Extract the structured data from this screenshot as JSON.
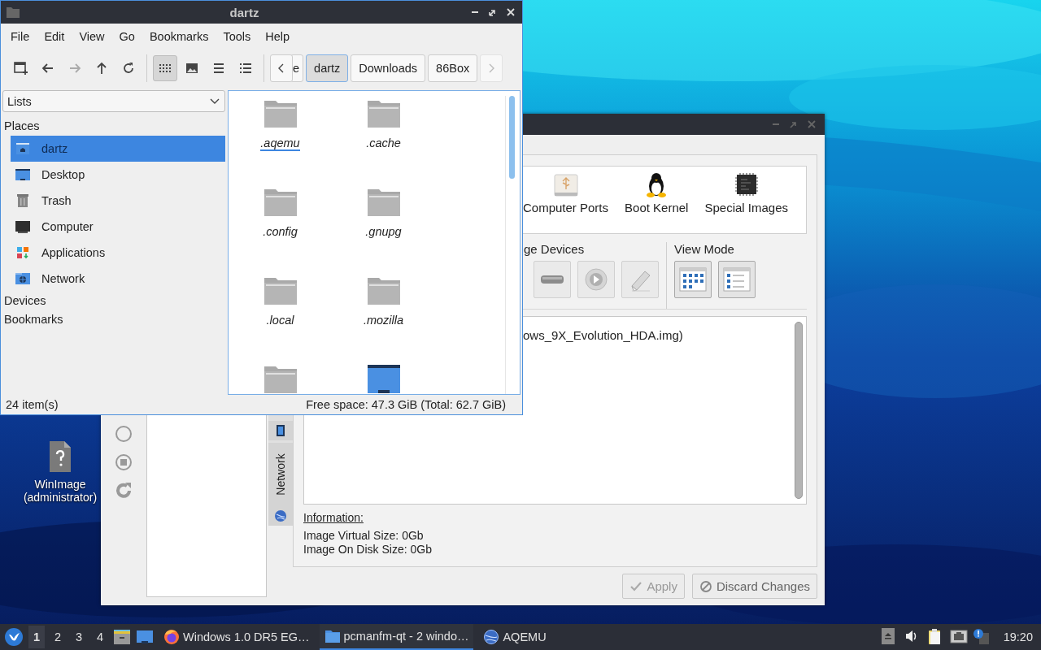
{
  "desktop": {
    "icons": [
      {
        "label": "WinImage (administrator)",
        "kind": "unknown"
      }
    ]
  },
  "aqemu_window": {
    "tool_icons": [
      {
        "kind": "circle"
      },
      {
        "kind": "stop"
      },
      {
        "kind": "reload"
      }
    ],
    "side_tabs": [
      {
        "kind": "device"
      },
      {
        "kind": "network",
        "label": "Network"
      }
    ],
    "categories": [
      {
        "label": "Computer Ports",
        "kind": "usb"
      },
      {
        "label": "Boot Kernel",
        "kind": "penguin"
      },
      {
        "label": "Special Images",
        "kind": "chip"
      }
    ],
    "devices_group": {
      "label": "ge Devices",
      "buttons": [
        {
          "kind": "drive"
        },
        {
          "kind": "media"
        },
        {
          "kind": "eraser"
        }
      ]
    },
    "view_mode": {
      "label": "View Mode",
      "buttons": [
        {
          "kind": "icons"
        },
        {
          "kind": "list"
        }
      ]
    },
    "image_list": [
      "ows_9X_Evolution_HDA.img)"
    ],
    "information": {
      "heading": "Information:",
      "lines": [
        "Image Virtual Size: 0Gb",
        "Image On Disk Size: 0Gb"
      ]
    },
    "buttons": [
      {
        "label": "Apply",
        "kind": "apply",
        "disabled": true
      },
      {
        "label": "Discard Changes",
        "kind": "discard",
        "disabled": false
      }
    ]
  },
  "file_manager": {
    "title": "dartz",
    "menu": [
      "File",
      "Edit",
      "View",
      "Go",
      "Bookmarks",
      "Tools",
      "Help"
    ],
    "nav_buttons": [
      {
        "kind": "new-tab",
        "disabled": false
      },
      {
        "kind": "back",
        "disabled": false
      },
      {
        "kind": "forward",
        "disabled": true
      },
      {
        "kind": "up",
        "disabled": false
      },
      {
        "kind": "reload",
        "disabled": false
      }
    ],
    "view_modes": [
      {
        "kind": "icons",
        "selected": true
      },
      {
        "kind": "thumbnails",
        "selected": false
      },
      {
        "kind": "compact",
        "selected": false
      },
      {
        "kind": "details",
        "selected": false
      }
    ],
    "path": [
      {
        "label": "e",
        "selected": false
      },
      {
        "label": "dartz",
        "selected": true
      },
      {
        "label": "Downloads",
        "selected": false
      },
      {
        "label": "86Box",
        "selected": false
      }
    ],
    "side_pane": {
      "selector": "Lists",
      "sections": [
        {
          "label": "Places",
          "items": [
            {
              "label": "dartz",
              "kind": "home",
              "selected": true
            },
            {
              "label": "Desktop",
              "kind": "desktop",
              "selected": false
            },
            {
              "label": "Trash",
              "kind": "trash",
              "selected": false
            },
            {
              "label": "Computer",
              "kind": "computer",
              "selected": false
            },
            {
              "label": "Applications",
              "kind": "applications",
              "selected": false
            },
            {
              "label": "Network",
              "kind": "network",
              "selected": false
            }
          ]
        },
        {
          "label": "Devices"
        },
        {
          "label": "Bookmarks"
        }
      ]
    },
    "files": [
      {
        "name": ".aqemu",
        "kind": "folder",
        "focused": true
      },
      {
        "name": ".cache",
        "kind": "folder",
        "focused": false
      },
      {
        "name": ".config",
        "kind": "folder",
        "focused": false
      },
      {
        "name": ".gnupg",
        "kind": "folder",
        "focused": false
      },
      {
        "name": ".local",
        "kind": "folder",
        "focused": false
      },
      {
        "name": ".mozilla",
        "kind": "folder",
        "focused": false
      },
      {
        "kind": "folder",
        "focused": false
      },
      {
        "kind": "desktop",
        "focused": false
      }
    ],
    "status_bar": {
      "count": "24 item(s)",
      "free_space": "Free space: 47.3 GiB (Total: 62.7 GiB)"
    }
  },
  "taskbar": {
    "workspaces": [
      {
        "label": "1",
        "selected": true
      },
      {
        "label": "2",
        "selected": false
      },
      {
        "label": "3",
        "selected": false
      },
      {
        "label": "4",
        "selected": false
      }
    ],
    "launchers": [
      {
        "kind": "file-manager"
      },
      {
        "kind": "desktop"
      }
    ],
    "tasks": [
      {
        "label": "Windows 1.0 DR5 EG…",
        "kind": "browser",
        "selected": false
      },
      {
        "label": "pcmanfm-qt - 2 windo…",
        "kind": "folder",
        "selected": true
      },
      {
        "label": "AQEMU",
        "kind": "globe",
        "selected": false
      }
    ],
    "tray": [
      {
        "kind": "eject"
      },
      {
        "kind": "volume"
      },
      {
        "kind": "clipboard"
      },
      {
        "kind": "network"
      },
      {
        "kind": "notification"
      }
    ],
    "clock": "19:20"
  }
}
